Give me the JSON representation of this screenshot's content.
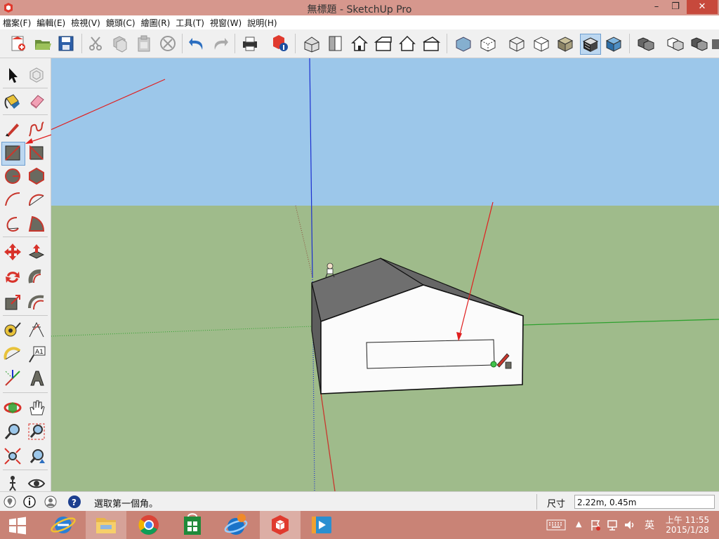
{
  "window": {
    "title": "無標題 - SketchUp Pro",
    "controls": [
      "minimize",
      "restore",
      "close"
    ]
  },
  "menu": [
    "檔案(F)",
    "編輯(E)",
    "檢視(V)",
    "鏡頭(C)",
    "繪圖(R)",
    "工具(T)",
    "視窗(W)",
    "說明(H)"
  ],
  "toolbar_icons": [
    "new-icon",
    "open-icon",
    "save-icon",
    "cut-icon",
    "copy-icon",
    "paste-icon",
    "erase-icon",
    "undo-icon",
    "redo-icon",
    "print-icon",
    "model-info-icon",
    "iso-view-icon",
    "top-view-icon",
    "front-view-icon",
    "right-view-icon",
    "back-view-icon",
    "left-view-icon",
    "xray-icon",
    "back-edges-icon",
    "wireframe-icon",
    "hidden-line-icon",
    "shaded-icon",
    "shaded-textures-icon",
    "monochrome-icon",
    "component-icon",
    "group-icon",
    "hide-icon"
  ],
  "left_tools": [
    "select-icon",
    "component-icon",
    "paint-icon",
    "eraser-icon",
    "line-icon",
    "freehand-icon",
    "rectangle-icon",
    "rotated-rectangle-icon",
    "circle-icon",
    "polygon-icon",
    "arc-icon",
    "two-point-arc-icon",
    "three-point-arc-icon",
    "pie-icon",
    "move-icon",
    "push-pull-icon",
    "rotate-icon",
    "follow-me-icon",
    "scale-icon",
    "offset-icon",
    "tape-measure-icon",
    "dimension-icon",
    "protractor-icon",
    "text-icon",
    "axes-icon",
    "3d-text-icon",
    "orbit-icon",
    "pan-icon",
    "zoom-icon",
    "zoom-window-icon",
    "zoom-extents-icon",
    "previous-view-icon",
    "walk-icon",
    "look-around-icon"
  ],
  "colors": {
    "sky": "#9cc7ea",
    "ground": "#9fbb8b",
    "title_bar": "#d6978d",
    "taskbar": "#c98376",
    "axis_blue": "#1b2ed0",
    "axis_red": "#c8372d",
    "axis_green": "#2ea02e",
    "annotation_arrow": "#e02020"
  },
  "status": {
    "hint": "選取第一個角。",
    "measure_label": "尺寸",
    "measure_value": "2.22m, 0.45m"
  },
  "taskbar": {
    "apps": [
      "windows-start-icon",
      "internet-explorer-icon",
      "file-explorer-icon",
      "chrome-icon",
      "store-icon",
      "ie-tool-icon",
      "sketchup-icon",
      "media-icon"
    ],
    "tray_language": "英",
    "time": "上午 11:55",
    "date": "2015/1/28"
  }
}
